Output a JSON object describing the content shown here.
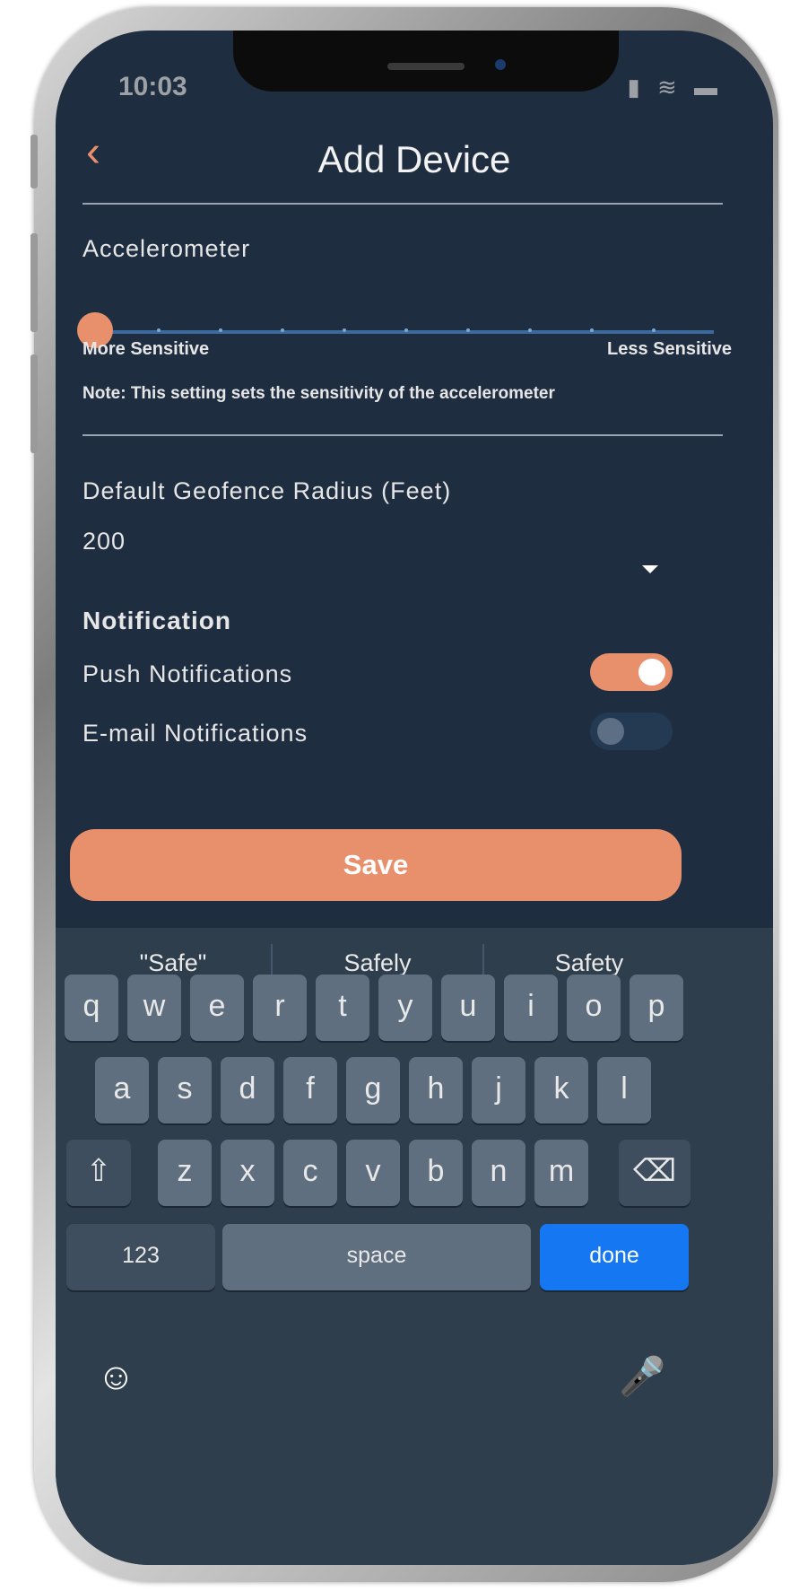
{
  "status_bar": {
    "time": "10:03",
    "icons": "▮ ≋ ▬"
  },
  "header": {
    "back_icon": "chevron-left-icon",
    "title": "Add Device"
  },
  "accelerometer": {
    "label": "Accelerometer",
    "slider_value_fraction": 0,
    "slider_steps": 10,
    "min_label": "More Sensitive",
    "max_label": "Less Sensitive",
    "note": "Note: This setting sets the sensitivity of the accelerometer"
  },
  "geofence": {
    "label": "Default Geofence Radius (Feet)",
    "value": "200"
  },
  "notification": {
    "heading": "Notification",
    "push": {
      "label": "Push Notifications",
      "enabled": true
    },
    "email": {
      "label": "E-mail Notifications",
      "enabled": false
    }
  },
  "save_label": "Save",
  "keyboard": {
    "suggestions": [
      "\"Safe\"",
      "Safely",
      "Safety"
    ],
    "row1": [
      "q",
      "w",
      "e",
      "r",
      "t",
      "y",
      "u",
      "i",
      "o",
      "p"
    ],
    "row2": [
      "a",
      "s",
      "d",
      "f",
      "g",
      "h",
      "j",
      "k",
      "l"
    ],
    "row3": [
      "z",
      "x",
      "c",
      "v",
      "b",
      "n",
      "m"
    ],
    "numbers_label": "123",
    "space_label": "space",
    "done_label": "done"
  },
  "colors": {
    "accent": "#e8906c",
    "background": "#1e2d40",
    "done_key": "#1578f2",
    "keyboard_bg": "#2f3e4c"
  }
}
